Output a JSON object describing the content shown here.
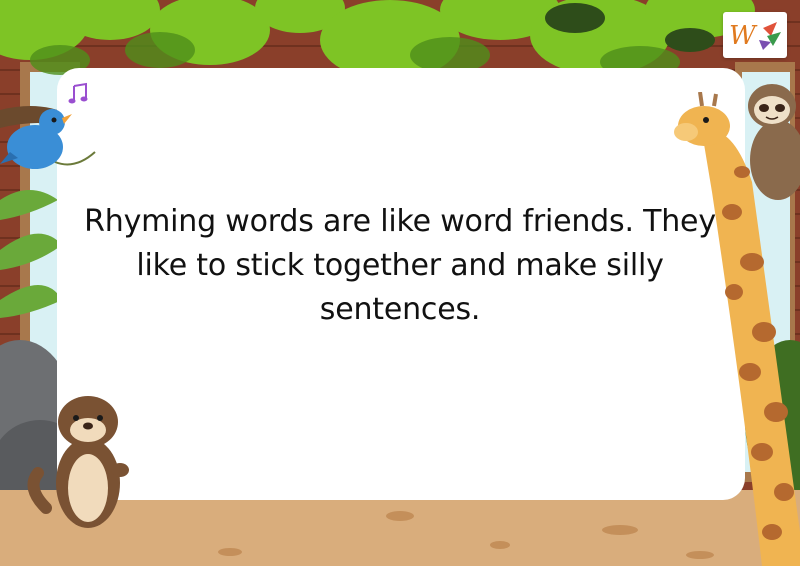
{
  "card": {
    "message": "Rhyming words are like word friends. They like to stick together and make silly sentences."
  },
  "logo": {
    "letter": "W"
  },
  "icons": {
    "music": "music-note-icon",
    "bird": "bluebird-illustration",
    "otter": "otter-illustration",
    "giraffe": "giraffe-illustration",
    "sloth": "sloth-illustration"
  },
  "colors": {
    "brick": "#8a3f2a",
    "leaf": "#7ec425",
    "ground": "#d9ad7c",
    "card": "#ffffff",
    "window": "#d9f1f4"
  }
}
